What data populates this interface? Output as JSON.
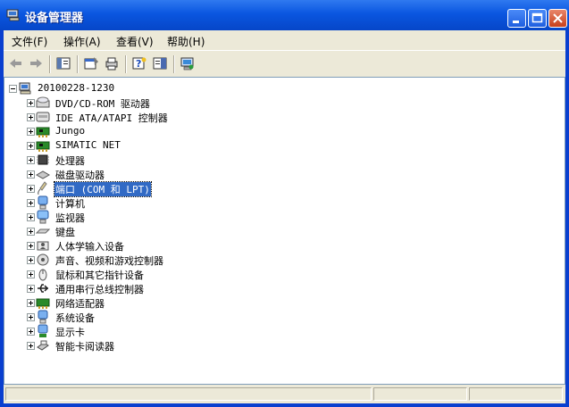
{
  "window": {
    "title": "设备管理器",
    "buttons": [
      "minimize-icon",
      "maximize-icon",
      "close-icon"
    ]
  },
  "menu": {
    "file": "文件(F)",
    "action": "操作(A)",
    "view": "查看(V)",
    "help": "帮助(H)"
  },
  "toolbar": {
    "icons": [
      "back-arrow-icon",
      "forward-arrow-icon",
      "show-hide-console-tree-icon",
      "properties-icon",
      "print-icon",
      "help-icon",
      "export-list-icon",
      "scan-hardware-icon"
    ]
  },
  "tree": {
    "root": "20100228-1230",
    "items": [
      {
        "label": "DVD/CD-ROM 驱动器",
        "icon": "dvd-drive-icon"
      },
      {
        "label": "IDE ATA/ATAPI 控制器",
        "icon": "ide-controller-icon"
      },
      {
        "label": "Jungo",
        "icon": "network-card-icon"
      },
      {
        "label": "SIMATIC NET",
        "icon": "network-card-icon"
      },
      {
        "label": "处理器",
        "icon": "processor-icon"
      },
      {
        "label": "磁盘驱动器",
        "icon": "disk-drive-icon"
      },
      {
        "label": "端口 (COM 和 LPT)",
        "icon": "port-icon",
        "selected": true
      },
      {
        "label": "计算机",
        "icon": "computer-icon"
      },
      {
        "label": "监视器",
        "icon": "monitor-icon"
      },
      {
        "label": "键盘",
        "icon": "keyboard-icon"
      },
      {
        "label": "人体学输入设备",
        "icon": "hid-icon"
      },
      {
        "label": "声音、视频和游戏控制器",
        "icon": "sound-icon"
      },
      {
        "label": "鼠标和其它指针设备",
        "icon": "mouse-icon"
      },
      {
        "label": "通用串行总线控制器",
        "icon": "usb-icon"
      },
      {
        "label": "网络适配器",
        "icon": "network-adapter-icon"
      },
      {
        "label": "系统设备",
        "icon": "system-device-icon"
      },
      {
        "label": "显示卡",
        "icon": "display-adapter-icon"
      },
      {
        "label": "智能卡阅读器",
        "icon": "smart-card-reader-icon"
      }
    ]
  }
}
